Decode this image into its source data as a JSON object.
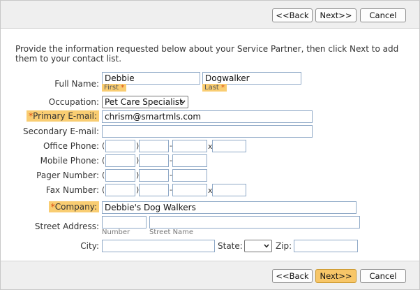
{
  "nav": {
    "back": "<<Back",
    "next": "Next>>",
    "cancel": "Cancel"
  },
  "intro": "Provide the information requested below about your Service Partner, then click Next to add them to your contact list.",
  "form": {
    "full_name": {
      "label": "Full Name:",
      "first_value": "Debbie",
      "first_caption": "First",
      "last_value": "Dogwalker",
      "last_caption": "Last",
      "required_mark": "*"
    },
    "occupation": {
      "label": "Occupation:",
      "value": "Pet Care Specialist"
    },
    "primary_email": {
      "required_mark": "*",
      "label": "Primary E-mail:",
      "value": "chrism@smartmls.com"
    },
    "secondary_email": {
      "label": "Secondary E-mail:",
      "value": ""
    },
    "office_phone": {
      "label": "Office Phone:"
    },
    "mobile_phone": {
      "label": "Mobile Phone:"
    },
    "pager_number": {
      "label": "Pager Number:"
    },
    "fax_number": {
      "label": "Fax Number:"
    },
    "phone_separators": {
      "open": "(",
      "close": ")",
      "dash": "-",
      "ext": "x"
    },
    "company": {
      "required_mark": "*",
      "label": "Company:",
      "value": "Debbie's Dog Walkers"
    },
    "street_address": {
      "label": "Street Address:",
      "number_caption": "Number",
      "street_caption": "Street Name"
    },
    "city": {
      "label": "City:",
      "value": ""
    },
    "state": {
      "label": "State:",
      "value": ""
    },
    "zip": {
      "label": "Zip:",
      "value": ""
    }
  },
  "colors": {
    "required_highlight": "#f9cd72",
    "primary_button": "#f7c668",
    "bar": "#efefef"
  }
}
